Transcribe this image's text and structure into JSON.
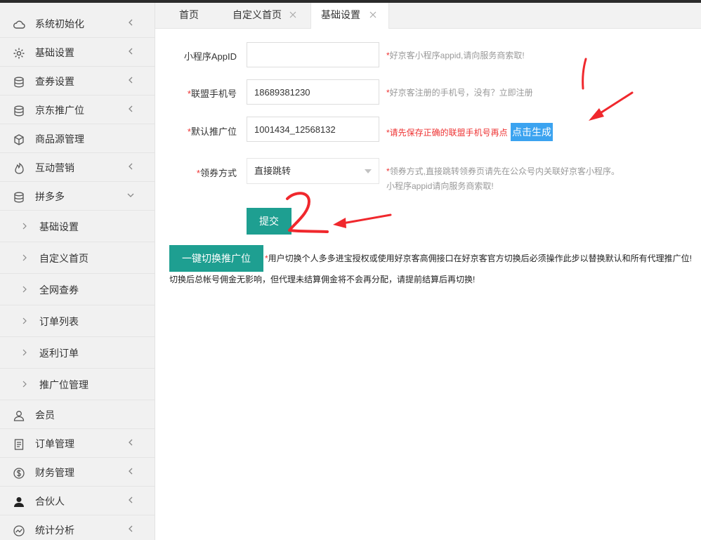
{
  "sidebar": {
    "items": [
      {
        "label": "系统初始化",
        "icon": "cloud-icon",
        "arrow": "left"
      },
      {
        "label": "基础设置",
        "icon": "gear-icon",
        "arrow": "left"
      },
      {
        "label": "查券设置",
        "icon": "database-icon",
        "arrow": "left"
      },
      {
        "label": "京东推广位",
        "icon": "database-icon",
        "arrow": "left"
      },
      {
        "label": "商品源管理",
        "icon": "cube-icon",
        "arrow": ""
      },
      {
        "label": "互动营销",
        "icon": "fire-icon",
        "arrow": "left"
      },
      {
        "label": "拼多多",
        "icon": "database-icon",
        "arrow": "down"
      }
    ],
    "sub_items": [
      "基础设置",
      "自定义首页",
      "全网查券",
      "订单列表",
      "返利订单",
      "推广位管理"
    ],
    "bottom_items": [
      {
        "label": "会员",
        "icon": "user-icon",
        "arrow": ""
      },
      {
        "label": "订单管理",
        "icon": "document-icon",
        "arrow": "left"
      },
      {
        "label": "财务管理",
        "icon": "dollar-icon",
        "arrow": "left"
      },
      {
        "label": "合伙人",
        "icon": "person-icon",
        "arrow": "left"
      },
      {
        "label": "统计分析",
        "icon": "chart-icon",
        "arrow": "left"
      }
    ]
  },
  "tabs": [
    {
      "label": "首页",
      "closable": false,
      "active": false
    },
    {
      "label": "自定义首页",
      "closable": true,
      "active": false
    },
    {
      "label": "基础设置",
      "closable": true,
      "active": true
    }
  ],
  "form": {
    "appid": {
      "label": "小程序AppID",
      "value": "",
      "hint": "好京客小程序appid,请向服务商索取!"
    },
    "phone": {
      "label": "联盟手机号",
      "value": "18689381230",
      "hint": "好京客注册的手机号，没有？立即注册"
    },
    "pid": {
      "label": "默认推广位",
      "value": "1001434_12568132",
      "hint": "请先保存正确的联盟手机号再点",
      "generate_label": "点击生成"
    },
    "coupon_mode": {
      "label": "领券方式",
      "value": "直接跳转",
      "hint_line1": "领券方式,直接跳转领券页请先在公众号内关联好京客小程序。",
      "hint_line2": "小程序appid请向服务商索取!"
    },
    "submit_label": "提交",
    "required_mark": "*"
  },
  "switch": {
    "button_label": "一键切换推广位",
    "note_line1": "用户切换个人多多进宝授权或使用好京客高佣接口在好京客官方切换后必须操作此步以替换默认和所有代理推广位!",
    "note_line2": "切换后总帐号佣金无影响，但代理未结算佣金将不会再分配，请提前结算后再切换!"
  },
  "annotations": {
    "mark1": "1",
    "mark2": "2",
    "color": "#f0282d"
  },
  "colors": {
    "accent": "#1e9f91",
    "generate": "#3ba3f0",
    "required": "#e33333"
  }
}
